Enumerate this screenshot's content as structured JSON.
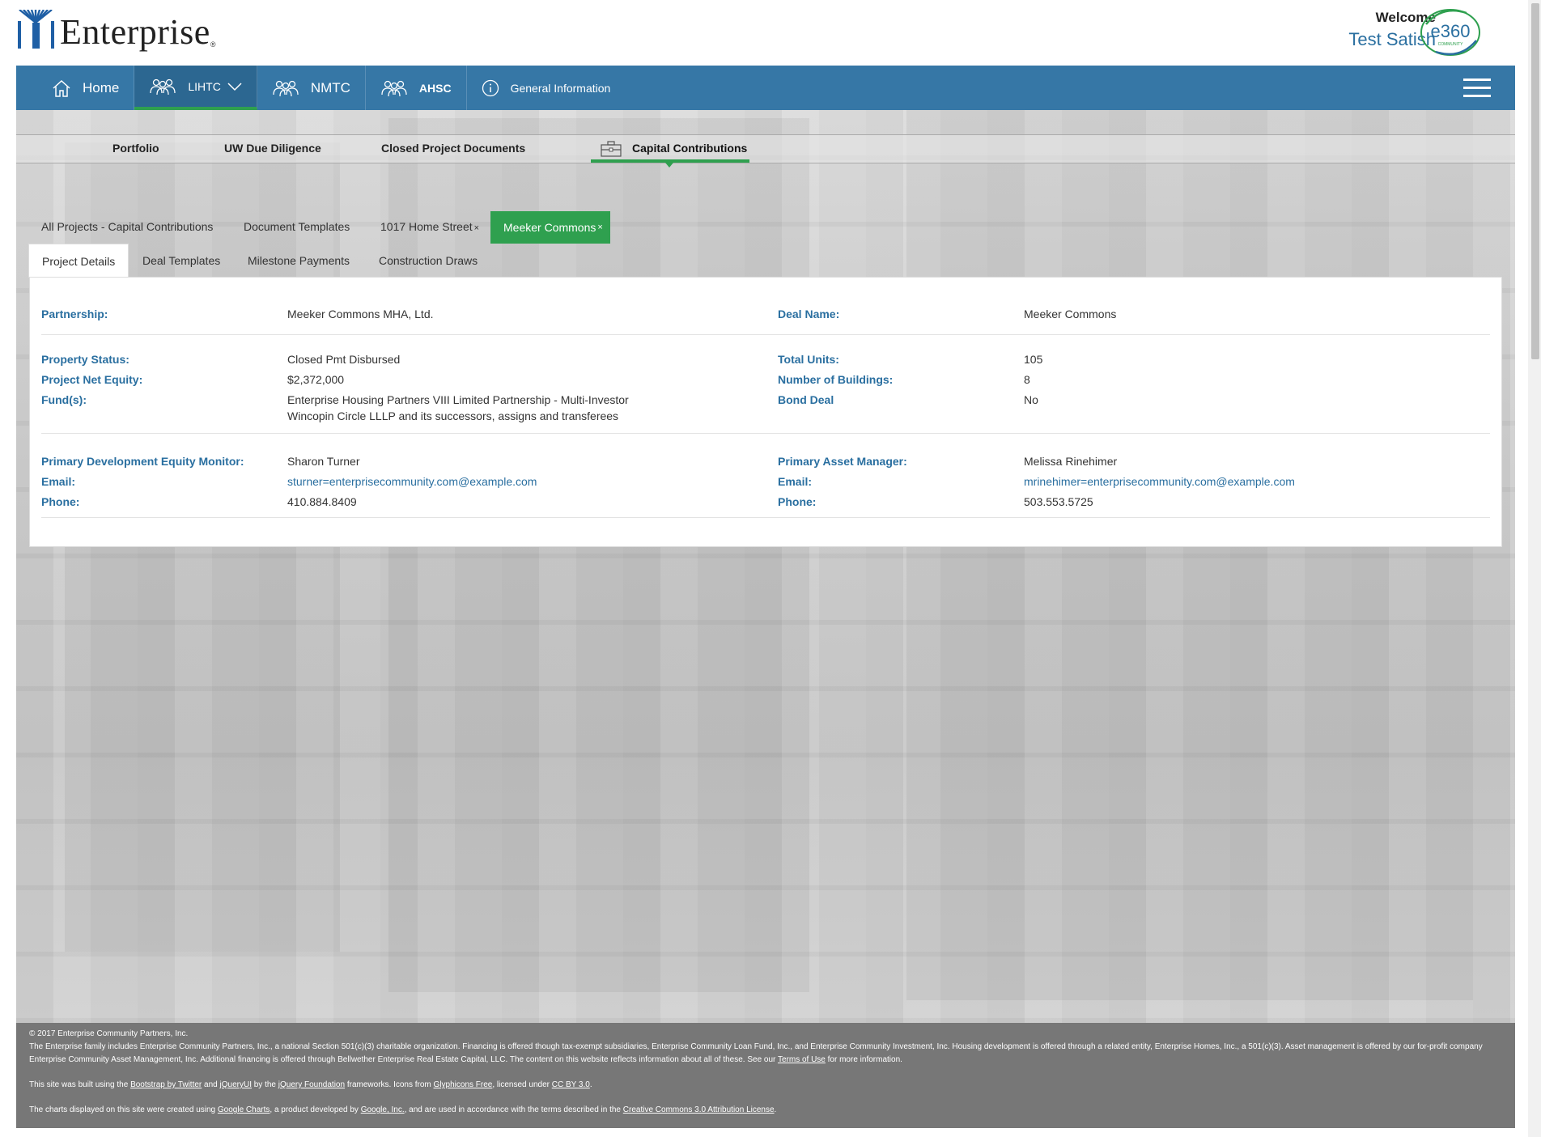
{
  "header": {
    "brand": "Enterprise",
    "welcome": "Welcome",
    "username": "Test Satish",
    "badge_text": "e360",
    "badge_sub": "COMMUNITY"
  },
  "nav": {
    "home": "Home",
    "lihtc": "LIHTC",
    "nmtc": "NMTC",
    "ahsc": "AHSC",
    "general": "General Information"
  },
  "subnav": {
    "portfolio": "Portfolio",
    "uw": "UW Due Diligence",
    "closed": "Closed Project Documents",
    "capital": "Capital Contributions"
  },
  "project_tabs": {
    "all": "All Projects - Capital Contributions",
    "templates": "Document Templates",
    "home_street": "1017 Home Street",
    "meeker": "Meeker Commons",
    "close": "×"
  },
  "detail_tabs": {
    "details": "Project Details",
    "deal": "Deal Templates",
    "milestone": "Milestone Payments",
    "draws": "Construction Draws"
  },
  "details": {
    "partnership_label": "Partnership:",
    "partnership": "Meeker Commons MHA, Ltd.",
    "deal_name_label": "Deal Name:",
    "deal_name": "Meeker Commons",
    "status_label": "Property Status:",
    "status": "Closed Pmt Disbursed",
    "net_equity_label": "Project Net Equity:",
    "net_equity": "$2,372,000",
    "funds_label": "Fund(s):",
    "fund_1": "Enterprise Housing Partners VIII Limited Partnership - Multi-Investor",
    "fund_2": "Wincopin Circle LLLP and its successors, assigns and transferees",
    "units_label": "Total Units:",
    "units": "105",
    "buildings_label": "Number of Buildings:",
    "buildings": "8",
    "bond_label": "Bond Deal",
    "bond": "No",
    "monitor_label": "Primary Development Equity Monitor:",
    "monitor": "Sharon Turner",
    "monitor_email_label": "Email:",
    "monitor_email": "sturner=enterprisecommunity.com@example.com",
    "monitor_phone_label": "Phone:",
    "monitor_phone": "410.884.8409",
    "manager_label": "Primary Asset Manager:",
    "manager": "Melissa Rinehimer",
    "manager_email_label": "Email:",
    "manager_email": "mrinehimer=enterprisecommunity.com@example.com",
    "manager_phone_label": "Phone:",
    "manager_phone": "503.553.5725"
  },
  "footer": {
    "copyright": "© 2017 Enterprise Community Partners, Inc.",
    "about_1": "The Enterprise family includes Enterprise Community Partners, Inc., a national Section 501(c)(3) charitable organization. Financing is offered though tax-exempt subsidiaries, Enterprise Community Loan Fund, Inc., and Enterprise Community Investment, Inc. Housing development is offered through a related entity, Enterprise Homes, Inc., a 501(c)(3). Asset management is offered by our for-profit company Enterprise Community Asset Management, Inc. Additional financing is offered through Bellwether Enterprise Real Estate Capital, LLC. The content on this website reflects information about all of these. See our",
    "terms": "Terms of Use",
    "about_2": "for more information.",
    "built_1": "This site was built using the",
    "bootstrap": "Bootstrap by Twitter",
    "and": "and",
    "jqueryui": "jQueryUI",
    "by_the": "by the",
    "jquery_foundation": "jQuery Foundation",
    "built_2": "frameworks. Icons from",
    "glyphicons": "Glyphicons Free",
    "built_3": ", licensed under",
    "ccby": "CC BY 3.0",
    "charts_1": "The charts displayed on this site were created using",
    "google_charts": "Google Charts",
    "charts_2": ", a product developed by",
    "google": "Google, Inc.",
    "charts_3": ", and are used in accordance with the terms described in the",
    "cc_license": "Creative Commons 3.0 Attribution License"
  },
  "colors": {
    "nav_blue": "#3677a6",
    "accent_green": "#2fa04f",
    "label_blue": "#2a6fa0",
    "footer_gray": "#777777"
  }
}
